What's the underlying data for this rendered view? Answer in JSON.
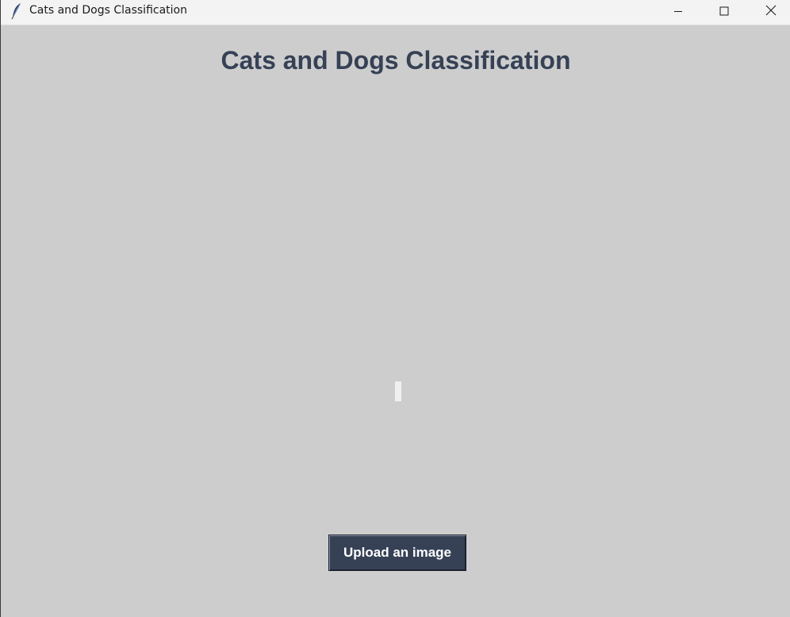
{
  "window": {
    "title": "Cats and Dogs Classification",
    "controls": {
      "minimize_icon": "minimize-icon",
      "maximize_icon": "maximize-icon",
      "close_icon": "close-icon"
    },
    "app_icon": "feather-icon"
  },
  "main": {
    "heading": "Cats and Dogs Classification",
    "upload_button_label": "Upload an image"
  },
  "colors": {
    "background": "#cdcdcd",
    "heading": "#364156",
    "button_bg": "#364156",
    "button_text": "#ffffff",
    "titlebar": "#f3f3f3"
  }
}
